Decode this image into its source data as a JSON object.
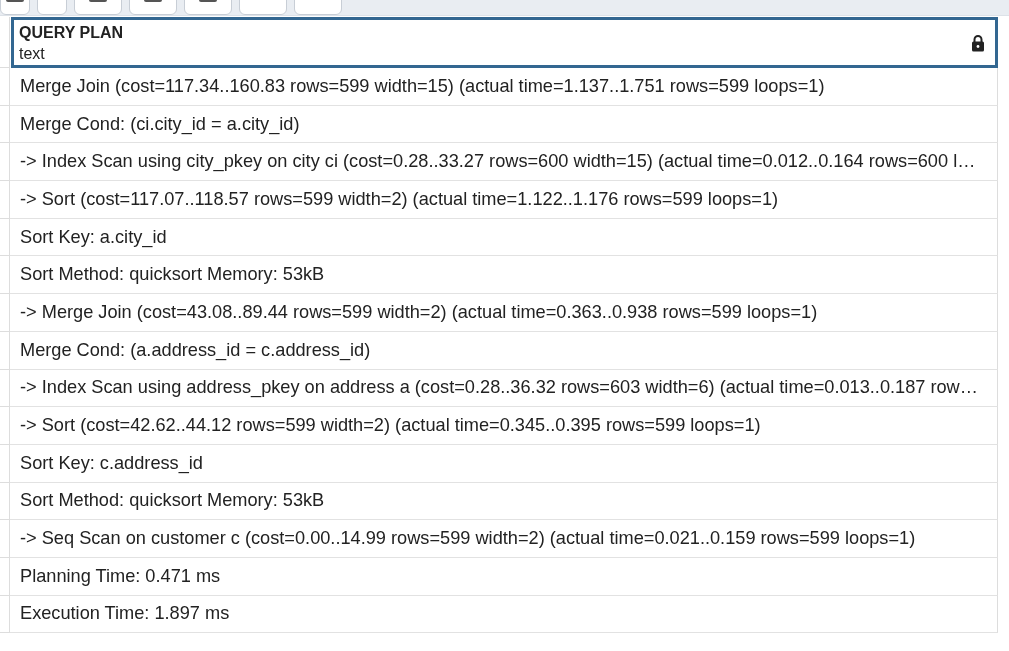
{
  "result_grid": {
    "column": {
      "name": "QUERY PLAN",
      "type": "text",
      "locked": true
    },
    "rows": [
      "Merge Join (cost=117.34..160.83 rows=599 width=15) (actual time=1.137..1.751 rows=599 loops=1)",
      "Merge Cond: (ci.city_id = a.city_id)",
      "-> Index Scan using city_pkey on city ci (cost=0.28..33.27 rows=600 width=15) (actual time=0.012..0.164 rows=600 l…",
      "-> Sort (cost=117.07..118.57 rows=599 width=2) (actual time=1.122..1.176 rows=599 loops=1)",
      "Sort Key: a.city_id",
      "Sort Method: quicksort Memory: 53kB",
      "-> Merge Join (cost=43.08..89.44 rows=599 width=2) (actual time=0.363..0.938 rows=599 loops=1)",
      "Merge Cond: (a.address_id = c.address_id)",
      "-> Index Scan using address_pkey on address a (cost=0.28..36.32 rows=603 width=6) (actual time=0.013..0.187 row…",
      "-> Sort (cost=42.62..44.12 rows=599 width=2) (actual time=0.345..0.395 rows=599 loops=1)",
      "Sort Key: c.address_id",
      "Sort Method: quicksort Memory: 53kB",
      "-> Seq Scan on customer c (cost=0.00..14.99 rows=599 width=2) (actual time=0.021..0.159 rows=599 loops=1)",
      "Planning Time: 0.471 ms",
      "Execution Time: 1.897 ms"
    ]
  }
}
